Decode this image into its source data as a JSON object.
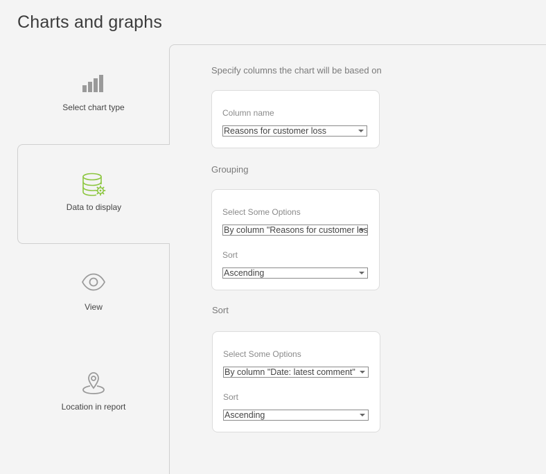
{
  "page": {
    "title": "Charts and graphs"
  },
  "steps": [
    {
      "label": "Select chart type",
      "icon": "bar-chart-icon",
      "active": false
    },
    {
      "label": "Data to display",
      "icon": "database-settings-icon",
      "active": true
    },
    {
      "label": "View",
      "icon": "eye-icon",
      "active": false
    },
    {
      "label": "Location in report",
      "icon": "map-pin-icon",
      "active": false
    }
  ],
  "columns": {
    "heading": "Specify columns the chart will be based on",
    "column_name_label": "Column name",
    "column_name_value": "Reasons for customer loss"
  },
  "grouping": {
    "heading": "Grouping",
    "options_label": "Select Some Options",
    "options_value": "By column \"Reasons for customer loss\"",
    "sort_label": "Sort",
    "sort_value": "Ascending"
  },
  "sort": {
    "heading": "Sort",
    "options_label": "Select Some Options",
    "options_value": "By column \"Date: latest comment\"",
    "sort_label": "Sort",
    "sort_value": "Ascending"
  },
  "colors": {
    "accent": "#8cc63f",
    "icon_gray": "#9a9a9a"
  }
}
